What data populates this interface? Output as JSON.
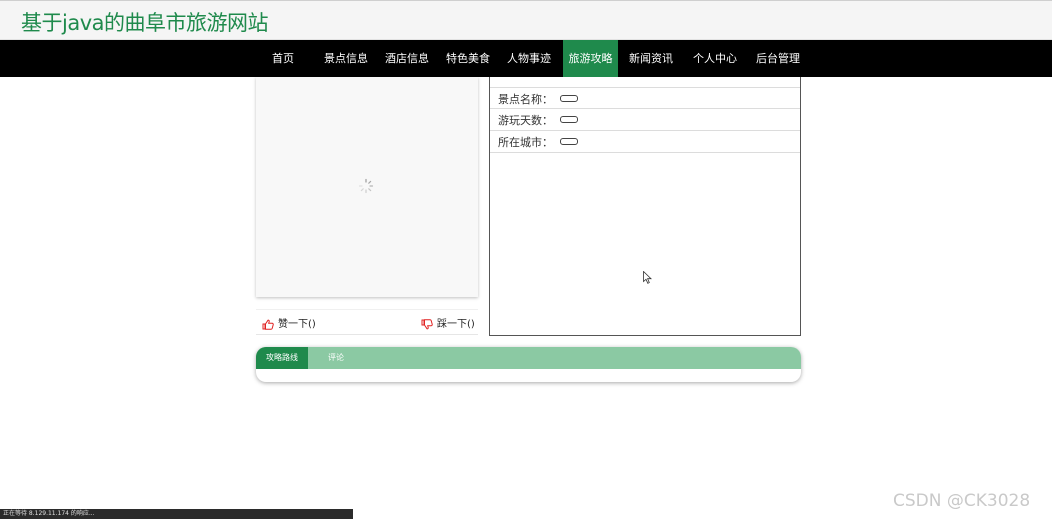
{
  "site": {
    "title": "基于java的曲阜市旅游网站"
  },
  "nav": {
    "items": [
      {
        "label": "首页"
      },
      {
        "label": "景点信息"
      },
      {
        "label": "酒店信息"
      },
      {
        "label": "特色美食"
      },
      {
        "label": "人物事迹"
      },
      {
        "label": "旅游攻略",
        "active": true
      },
      {
        "label": "新闻资讯"
      },
      {
        "label": "个人中心"
      },
      {
        "label": "后台管理"
      }
    ],
    "active_color": "#1f8a4c",
    "bar_color": "#000000"
  },
  "votes": {
    "like_label": "赞一下()",
    "dislike_label": "踩一下()",
    "like_icon": "thumbs-up-icon",
    "dislike_icon": "thumbs-down-icon",
    "icon_color": "#e02020"
  },
  "info": {
    "rows": [
      {
        "label": "景点名称：",
        "value": ""
      },
      {
        "label": "游玩天数：",
        "value": ""
      },
      {
        "label": "所在城市：",
        "value": ""
      }
    ]
  },
  "tabs": {
    "items": [
      {
        "label": "攻略路线",
        "active": true
      },
      {
        "label": "评论"
      }
    ],
    "bar_color": "#8bc9a3",
    "active_color": "#1f8a4c"
  },
  "status_bar": {
    "text": "正在等待 8.129.11.174 的响应..."
  },
  "watermark": {
    "text": "CSDN @CK3028"
  }
}
